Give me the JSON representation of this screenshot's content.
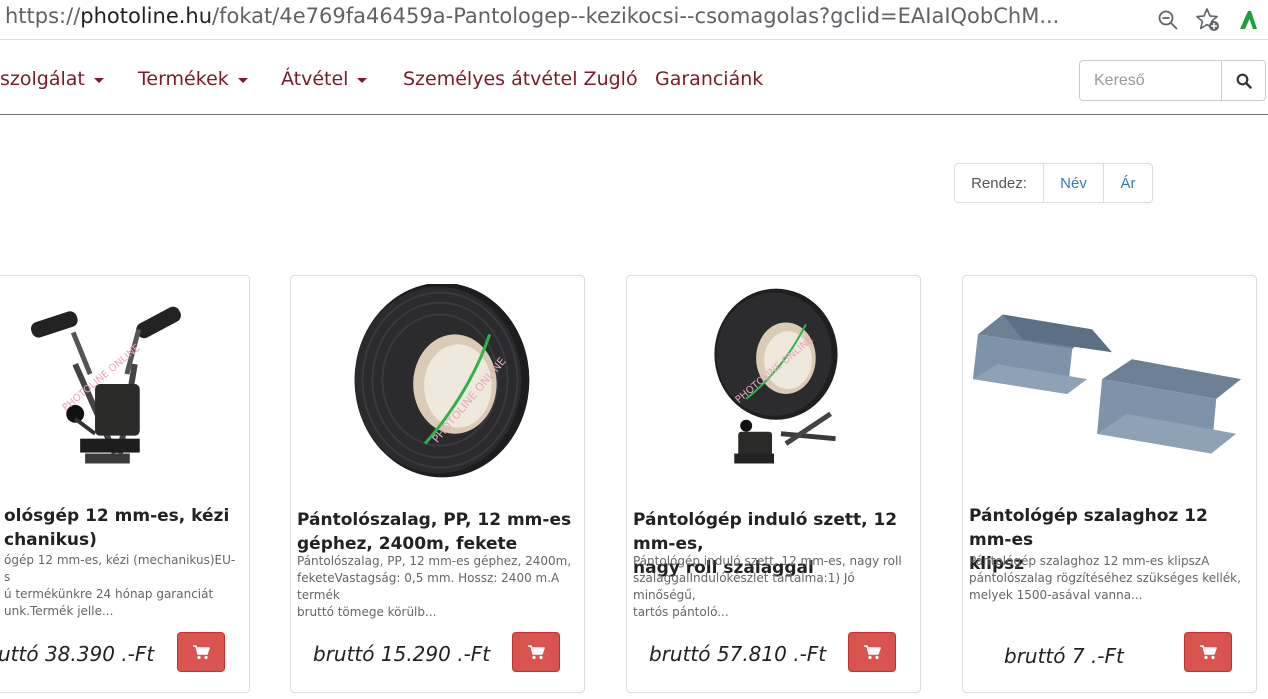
{
  "browser": {
    "url_host": "photoline.hu",
    "url_prefix": "https://",
    "url_path": "/fokat/4e769fa46459a-Pantologep--kezikocsi--csomagolas?gclid=EAIaIQobChM..."
  },
  "nav": {
    "items": [
      {
        "label": "szolgálat",
        "has_caret": true
      },
      {
        "label": "Termékek",
        "has_caret": true
      },
      {
        "label": "Átvétel",
        "has_caret": true
      },
      {
        "label": "Személyes átvétel Zugló",
        "has_caret": false
      },
      {
        "label": "Garanciánk",
        "has_caret": false
      }
    ],
    "search_placeholder": "Kereső"
  },
  "sort": {
    "label": "Rendez:",
    "options": [
      "Név",
      "Ár"
    ]
  },
  "products": [
    {
      "title_lines": [
        "olósgép 12 mm-es, kézi",
        "chanikus)"
      ],
      "description_lines": [
        "ógép 12 mm-es, kézi (mechanikus)EU-s",
        "ú termékünkre 24 hónap garanciát",
        "unk.Termék jelle..."
      ],
      "price": "uttó 38.390 .-Ft"
    },
    {
      "title_lines": [
        "Pántolószalag, PP, 12 mm-es",
        "géphez, 2400m, fekete"
      ],
      "description_lines": [
        "Pántolószalag, PP, 12 mm-es géphez, 2400m,",
        "feketeVastagság: 0,5 mm. Hossz: 2400 m.A termék",
        "bruttó tömege körülb..."
      ],
      "price": "bruttó 15.290 .-Ft"
    },
    {
      "title_lines": [
        "Pántológép induló szett, 12 mm-es,",
        "nagy roll szalaggal"
      ],
      "description_lines": [
        "Pántológép induló szett, 12 mm-es, nagy roll",
        "szalaggalIndulókészlet tartalma:1) Jó minőségű,",
        "tartós pántoló..."
      ],
      "price": "bruttó 57.810 .-Ft"
    },
    {
      "title_lines": [
        "Pántológép szalaghoz 12 mm-es",
        "klipsz"
      ],
      "description_lines": [
        "Pántológép szalaghoz 12 mm-es klipszA",
        "pántolószalag rögzítéséhez szükséges kellék,",
        "melyek 1500-asával vanna..."
      ],
      "price": "bruttó 7 .-Ft"
    }
  ],
  "watermark": "PHOTOLINE ONLINE",
  "colors": {
    "menu_text": "#7a1a2a",
    "link": "#337ab7",
    "cart_button": "#d9534f",
    "brand_logo": "#1e9e3e"
  }
}
